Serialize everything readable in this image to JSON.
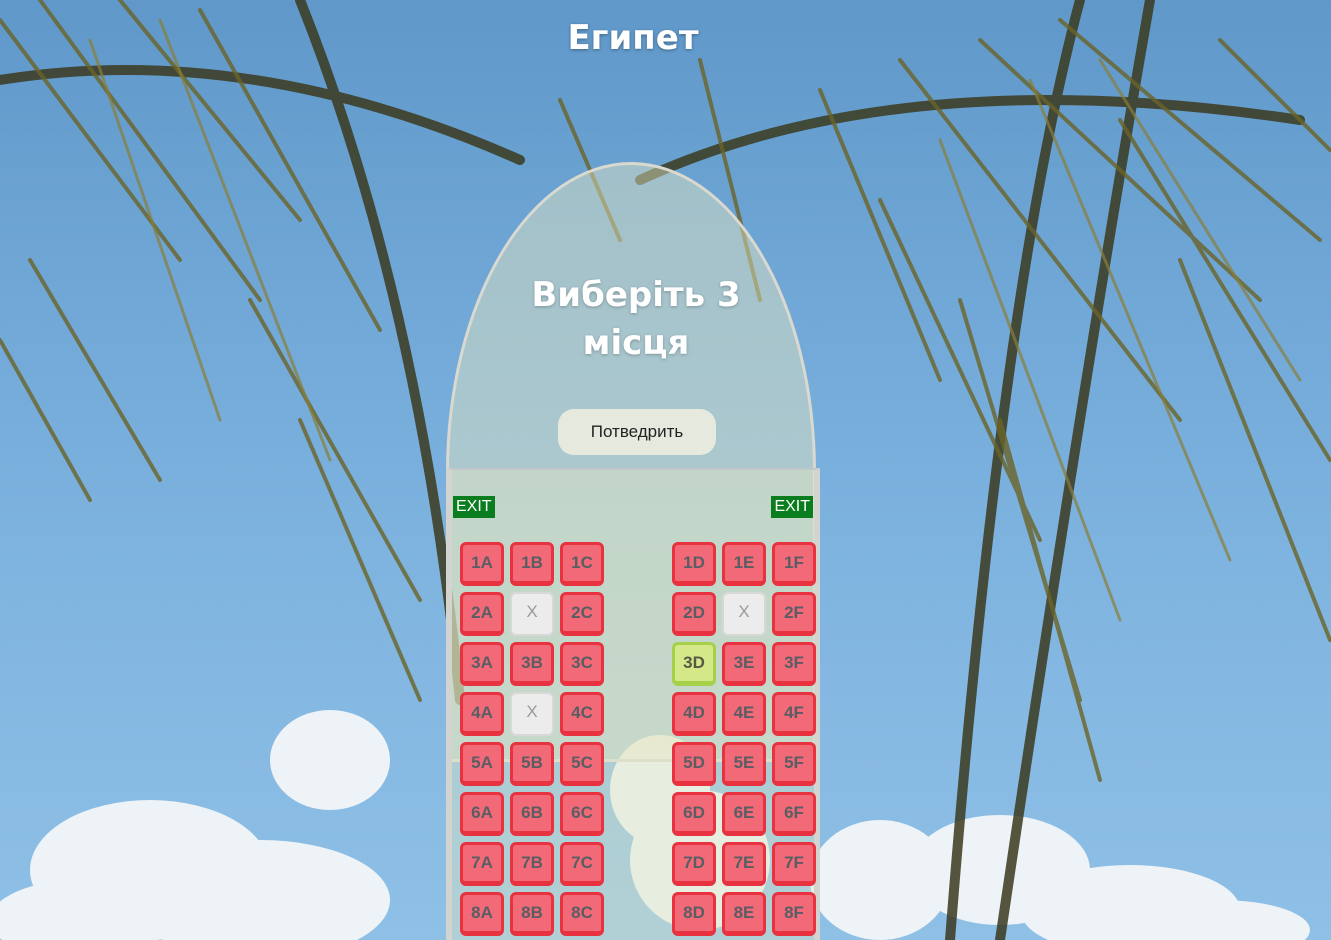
{
  "header": {
    "title": "Египет"
  },
  "booking": {
    "instruction": "Виберіть 3 місця",
    "confirm_label": "Потведрить",
    "exit_left": "EXIT",
    "exit_right": "EXIT"
  },
  "seat_rows": [
    {
      "row": 1,
      "seats": [
        {
          "label": "1A",
          "status": "available"
        },
        {
          "label": "1B",
          "status": "available"
        },
        {
          "label": "1C",
          "status": "available"
        },
        {
          "label": "1D",
          "status": "available"
        },
        {
          "label": "1E",
          "status": "available"
        },
        {
          "label": "1F",
          "status": "available"
        }
      ]
    },
    {
      "row": 2,
      "seats": [
        {
          "label": "2A",
          "status": "available"
        },
        {
          "label": "X",
          "status": "occupied"
        },
        {
          "label": "2C",
          "status": "available"
        },
        {
          "label": "2D",
          "status": "available"
        },
        {
          "label": "X",
          "status": "occupied"
        },
        {
          "label": "2F",
          "status": "available"
        }
      ]
    },
    {
      "row": 3,
      "seats": [
        {
          "label": "3A",
          "status": "available"
        },
        {
          "label": "3B",
          "status": "available"
        },
        {
          "label": "3C",
          "status": "available"
        },
        {
          "label": "3D",
          "status": "selected"
        },
        {
          "label": "3E",
          "status": "available"
        },
        {
          "label": "3F",
          "status": "available"
        }
      ]
    },
    {
      "row": 4,
      "seats": [
        {
          "label": "4A",
          "status": "available"
        },
        {
          "label": "X",
          "status": "occupied"
        },
        {
          "label": "4C",
          "status": "available"
        },
        {
          "label": "4D",
          "status": "available"
        },
        {
          "label": "4E",
          "status": "available"
        },
        {
          "label": "4F",
          "status": "available"
        }
      ]
    },
    {
      "row": 5,
      "seats": [
        {
          "label": "5A",
          "status": "available"
        },
        {
          "label": "5B",
          "status": "available"
        },
        {
          "label": "5C",
          "status": "available"
        },
        {
          "label": "5D",
          "status": "available"
        },
        {
          "label": "5E",
          "status": "available"
        },
        {
          "label": "5F",
          "status": "available"
        }
      ]
    },
    {
      "row": 6,
      "seats": [
        {
          "label": "6A",
          "status": "available"
        },
        {
          "label": "6B",
          "status": "available"
        },
        {
          "label": "6C",
          "status": "available"
        },
        {
          "label": "6D",
          "status": "available"
        },
        {
          "label": "6E",
          "status": "available"
        },
        {
          "label": "6F",
          "status": "available"
        }
      ]
    },
    {
      "row": 7,
      "seats": [
        {
          "label": "7A",
          "status": "available"
        },
        {
          "label": "7B",
          "status": "available"
        },
        {
          "label": "7C",
          "status": "available"
        },
        {
          "label": "7D",
          "status": "available"
        },
        {
          "label": "7E",
          "status": "available"
        },
        {
          "label": "7F",
          "status": "available"
        }
      ]
    },
    {
      "row": 8,
      "seats": [
        {
          "label": "8A",
          "status": "available"
        },
        {
          "label": "8B",
          "status": "available"
        },
        {
          "label": "8C",
          "status": "available"
        },
        {
          "label": "8D",
          "status": "available"
        },
        {
          "label": "8E",
          "status": "available"
        },
        {
          "label": "8F",
          "status": "available"
        }
      ]
    }
  ],
  "colors": {
    "available": "#f26a78",
    "available_border": "#e8323f",
    "occupied": "#ececec",
    "selected": "#d4e88a",
    "exit": "#0a7d1f"
  },
  "background": {
    "scene": "palm leaves against blue sky with clouds"
  }
}
